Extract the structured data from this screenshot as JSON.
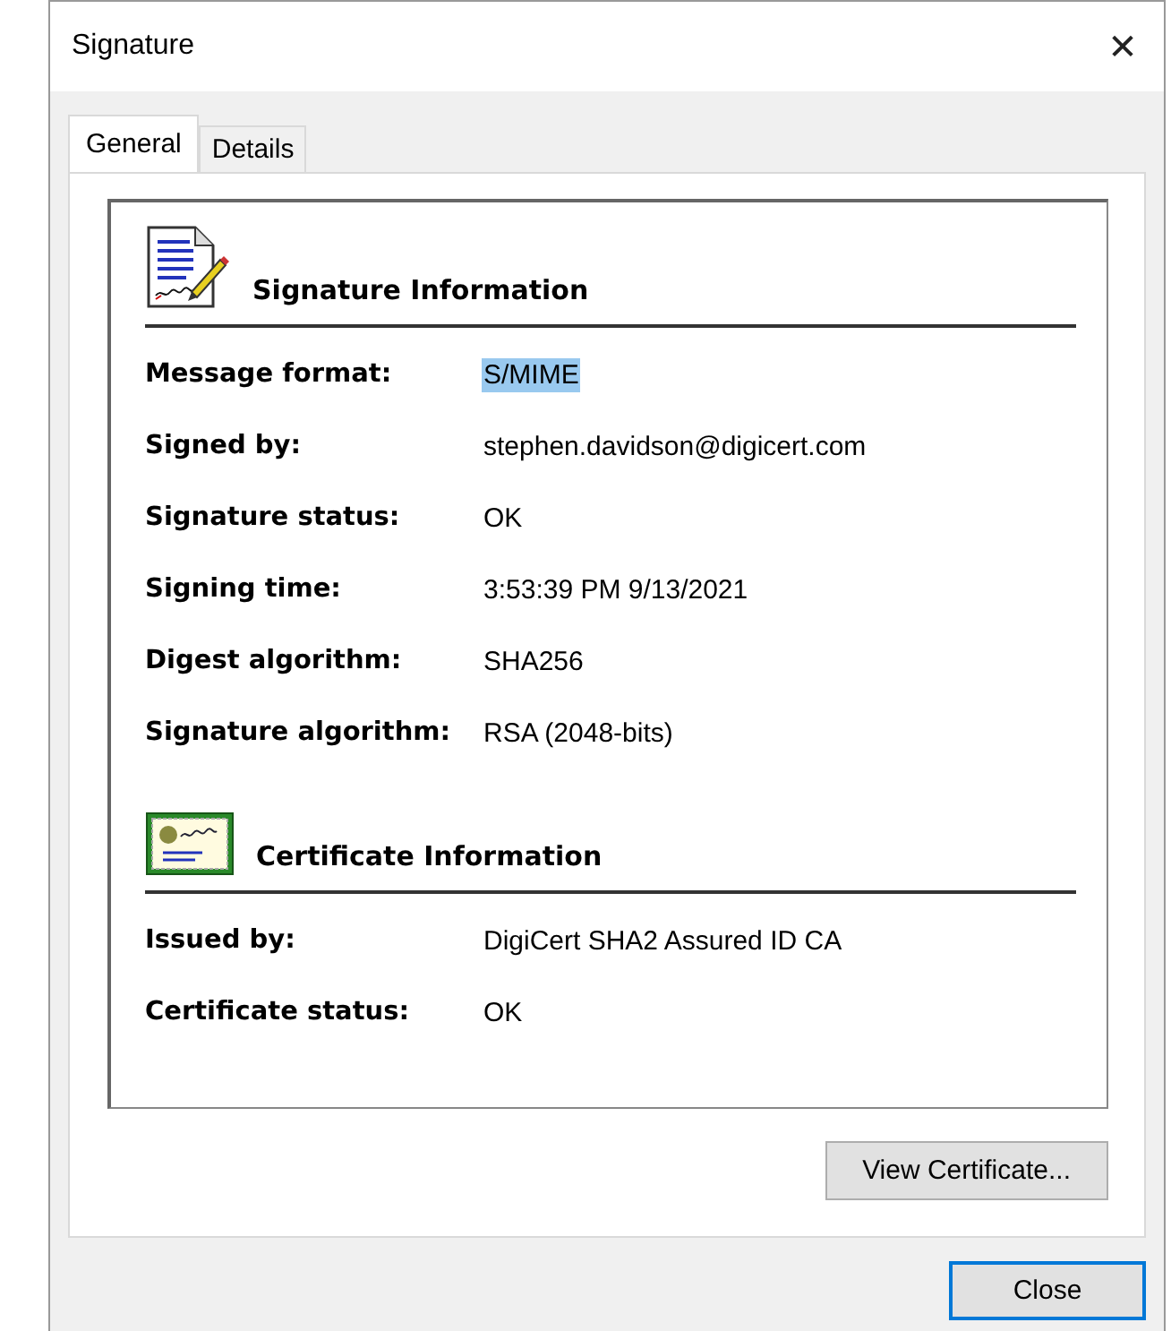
{
  "window": {
    "title": "Signature",
    "close": "✕"
  },
  "tabs": [
    {
      "label": "General",
      "selected": true
    },
    {
      "label": "Details",
      "selected": false
    }
  ],
  "sections": [
    {
      "kind": "signature",
      "title": "Signature Information",
      "rows": [
        {
          "label": "Message format:",
          "value": "S/MIME",
          "selected": true
        },
        {
          "label": "Signed by:",
          "value": "stephen.davidson@digicert.com",
          "selected": false
        },
        {
          "label": "Signature status:",
          "value": "OK",
          "selected": false
        },
        {
          "label": "Signing time:",
          "value": "3:53:39 PM 9/13/2021",
          "selected": false
        },
        {
          "label": "Digest algorithm:",
          "value": "SHA256",
          "selected": false
        },
        {
          "label": "Signature algorithm:",
          "value": "RSA (2048-bits)",
          "selected": false
        }
      ]
    },
    {
      "kind": "certificate",
      "title": "Certificate Information",
      "rows": [
        {
          "label": "Issued by:",
          "value": "DigiCert SHA2 Assured ID CA",
          "selected": false
        },
        {
          "label": "Certificate status:",
          "value": "OK",
          "selected": false
        }
      ]
    }
  ],
  "view_button": "View Certificate...",
  "close_button": "Close"
}
